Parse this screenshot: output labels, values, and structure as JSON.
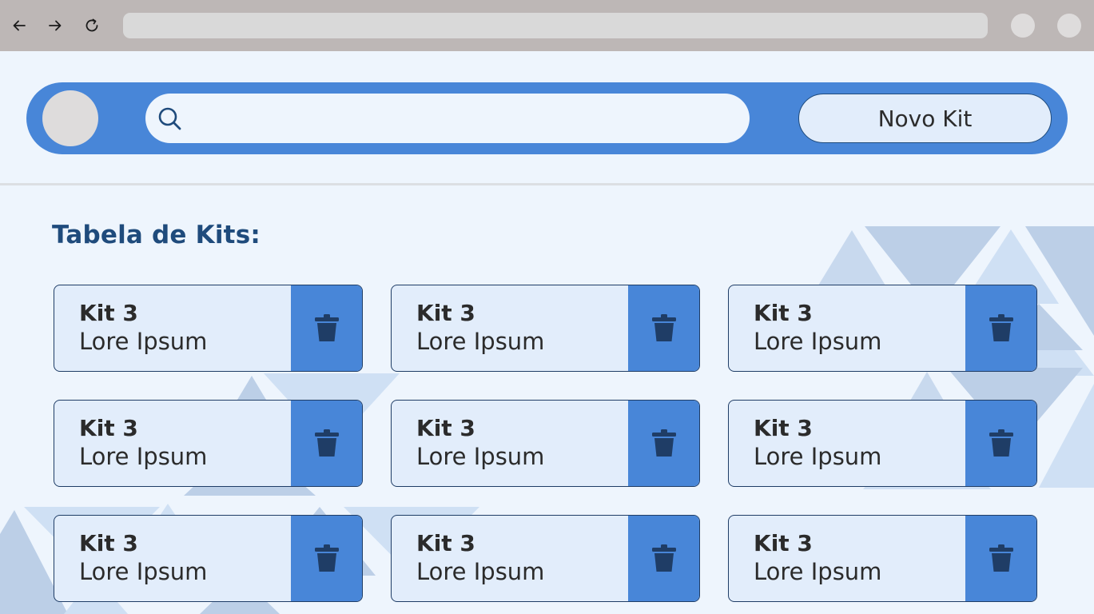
{
  "browser": {
    "back_icon": "arrow-left-icon",
    "forward_icon": "arrow-right-icon",
    "reload_icon": "reload-icon",
    "address": ""
  },
  "header": {
    "search_placeholder": "",
    "search_value": "",
    "new_kit_label": "Novo Kit"
  },
  "page": {
    "title": "Tabela de Kits:"
  },
  "kits": [
    {
      "name": "Kit 3",
      "description": "Lore Ipsum"
    },
    {
      "name": "Kit 3",
      "description": "Lore Ipsum"
    },
    {
      "name": "Kit 3",
      "description": "Lore Ipsum"
    },
    {
      "name": "Kit 3",
      "description": "Lore Ipsum"
    },
    {
      "name": "Kit 3",
      "description": "Lore Ipsum"
    },
    {
      "name": "Kit 3",
      "description": "Lore Ipsum"
    },
    {
      "name": "Kit 3",
      "description": "Lore Ipsum"
    },
    {
      "name": "Kit 3",
      "description": "Lore Ipsum"
    },
    {
      "name": "Kit 3",
      "description": "Lore Ipsum"
    }
  ],
  "colors": {
    "primary": "#4886d8",
    "dark_blue": "#1f4b7c",
    "card_bg": "#e2edfb",
    "page_bg": "#eef5fd",
    "trash": "#1f3d66"
  }
}
